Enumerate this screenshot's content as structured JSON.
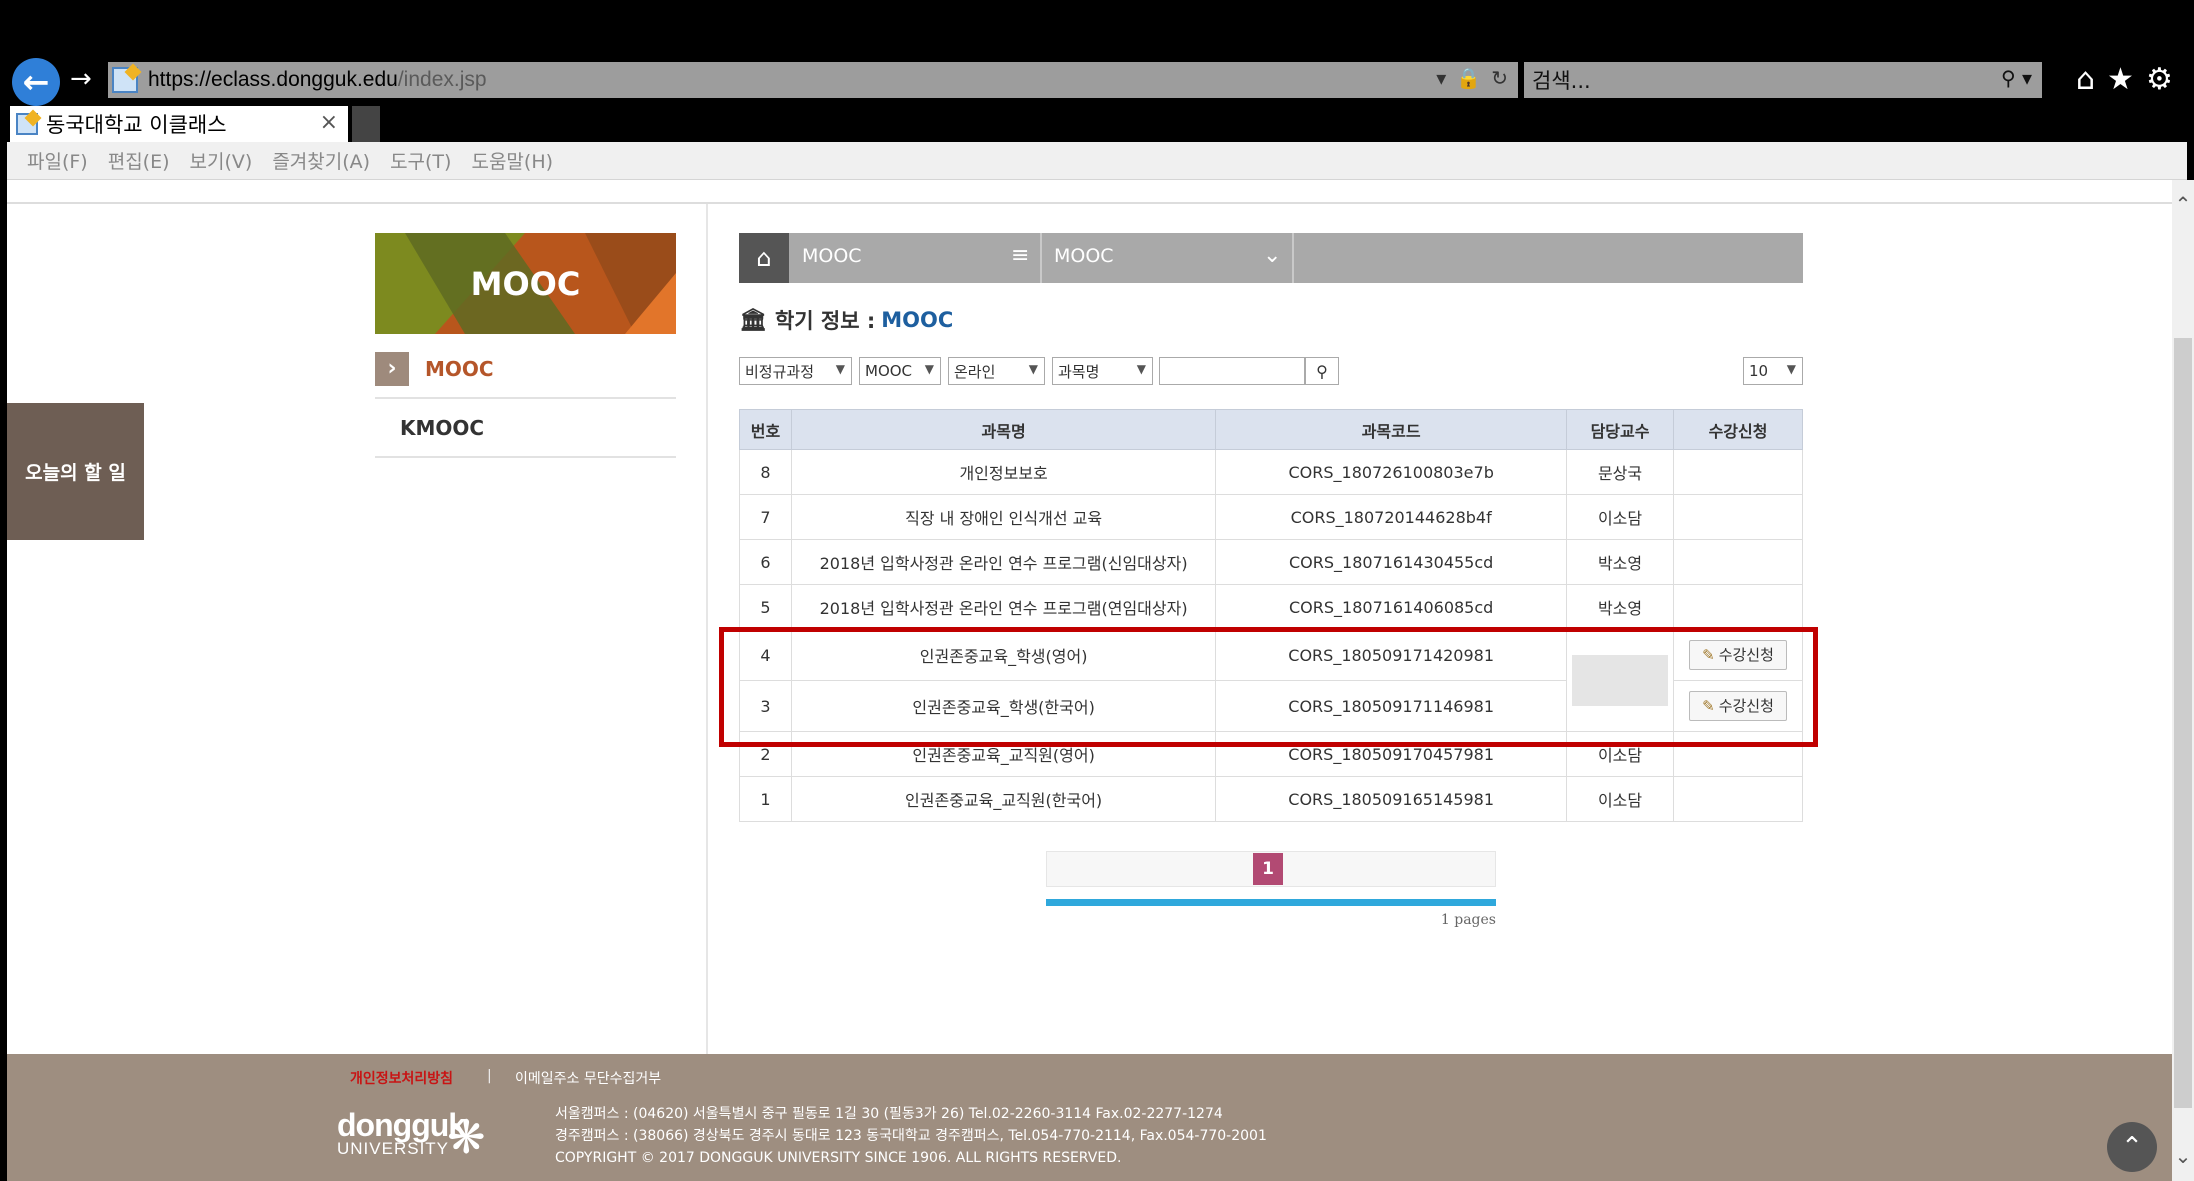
{
  "browser": {
    "url_host": "https://eclass.dongguk.edu",
    "url_path": "/index.jsp",
    "url_scheme": "https://",
    "url_domain": "eclass.dongguk.edu",
    "search_placeholder": "검색...",
    "tab_title": "동국대학교 이클래스",
    "menu": [
      "파일(F)",
      "편집(E)",
      "보기(V)",
      "즐겨찾기(A)",
      "도구(T)",
      "도움말(H)"
    ]
  },
  "sidebar": {
    "todo": "오늘의 할 일",
    "banner_title": "MOOC",
    "items": [
      {
        "label": "MOOC",
        "active": true
      },
      {
        "label": "KMOOC",
        "active": false
      }
    ]
  },
  "breadcrumb": {
    "level1": "MOOC",
    "level2": "MOOC"
  },
  "semester": {
    "label": "학기 정보 :",
    "value": "MOOC"
  },
  "filters": {
    "category": "비정규과정",
    "type": "MOOC",
    "mode": "온라인",
    "field": "과목명",
    "page_size": "10"
  },
  "table": {
    "headers": [
      "번호",
      "과목명",
      "과목코드",
      "담당교수",
      "수강신청"
    ],
    "rows": [
      {
        "no": "8",
        "name": "개인정보보호",
        "code": "CORS_180726100803e7b",
        "prof": "문상국",
        "enroll": ""
      },
      {
        "no": "7",
        "name": "직장 내 장애인 인식개선 교육",
        "code": "CORS_180720144628b4f",
        "prof": "이소담",
        "enroll": ""
      },
      {
        "no": "6",
        "name": "2018년 입학사정관 온라인 연수 프로그램(신임대상자)",
        "code": "CORS_1807161430455cd",
        "prof": "박소영",
        "enroll": ""
      },
      {
        "no": "5",
        "name": "2018년 입학사정관 온라인 연수 프로그램(연임대상자)",
        "code": "CORS_1807161406085cd",
        "prof": "박소영",
        "enroll": ""
      },
      {
        "no": "4",
        "name": "인권존중교육_학생(영어)",
        "code": "CORS_180509171420981",
        "prof": "",
        "enroll": "수강신청"
      },
      {
        "no": "3",
        "name": "인권존중교육_학생(한국어)",
        "code": "CORS_180509171146981",
        "prof": "",
        "enroll": "수강신청"
      },
      {
        "no": "2",
        "name": "인권존중교육_교직원(영어)",
        "code": "CORS_180509170457981",
        "prof": "이소담",
        "enroll": ""
      },
      {
        "no": "1",
        "name": "인권존중교육_교직원(한국어)",
        "code": "CORS_180509165145981",
        "prof": "이소담",
        "enroll": ""
      }
    ]
  },
  "pagination": {
    "current": "1",
    "summary": "1 pages"
  },
  "footer": {
    "privacy": "개인정보처리방침",
    "separator": "|",
    "email_policy": "이메일주소 무단수집거부",
    "logo_line1": "dongguk",
    "logo_line2": "UNIVERSITY",
    "address1": "서울캠퍼스 : (04620) 서울특별시 중구 필동로 1길 30 (필동3가 26) Tel.02-2260-3114 Fax.02-2277-1274",
    "address2": "경주캠퍼스 : (38066) 경상북도 경주시 동대로 123 동국대학교 경주캠퍼스, Tel.054-770-2114, Fax.054-770-2001",
    "copyright": "COPYRIGHT © 2017 DONGGUK UNIVERSITY SINCE 1906. ALL RIGHTS RESERVED."
  },
  "icons": {
    "back": "back-arrow-icon",
    "forward": "forward-arrow-icon",
    "home": "home-icon",
    "favorites": "star-icon",
    "settings": "gear-icon",
    "search": "magnifier-icon",
    "top": "chevron-up-icon"
  },
  "colors": {
    "todo_bg": "#6e5e54",
    "active_nav": "#b5562a",
    "highlight": "#c00000",
    "pager_active": "#b24a73",
    "footer_bg": "#9e8e80"
  }
}
